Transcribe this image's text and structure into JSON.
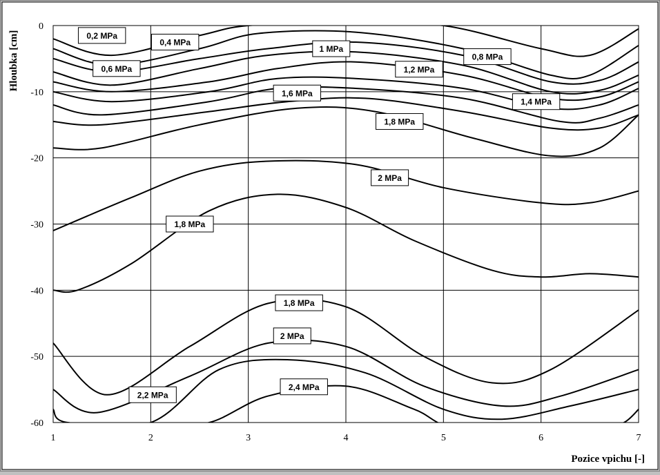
{
  "chart_data": {
    "type": "line",
    "title": "",
    "xlabel": "Pozice vpichu  [-]",
    "ylabel": "Hloubka  [cm]",
    "xlim": [
      1,
      7
    ],
    "ylim": [
      -60,
      0
    ],
    "x_ticks": [
      "1",
      "2",
      "3",
      "4",
      "5",
      "6",
      "7"
    ],
    "y_ticks": [
      "0",
      "-10",
      "-20",
      "-30",
      "-40",
      "-50",
      "-60"
    ],
    "grid": true,
    "legend": "none",
    "series": [
      {
        "x": [
          1,
          1.6,
          2.5,
          3,
          4,
          5,
          6,
          6.5,
          7
        ],
        "y": [
          -2,
          -4.5,
          -1.5,
          0,
          0.5,
          0,
          -3.5,
          -4.5,
          -0.5
        ]
      },
      {
        "x": [
          1,
          1.6,
          2.5,
          3.1,
          4.1,
          5.2,
          6.1,
          6.5,
          7
        ],
        "y": [
          -3.5,
          -6,
          -3.5,
          -1.2,
          -1,
          -3.5,
          -7.5,
          -7.5,
          -3
        ]
      },
      {
        "x": [
          1,
          1.6,
          2.5,
          3.2,
          4.1,
          5.2,
          6.1,
          6.6,
          7
        ],
        "y": [
          -5,
          -7,
          -5,
          -3.5,
          -2.5,
          -4.5,
          -8.5,
          -8.3,
          -5.5
        ]
      },
      {
        "x": [
          1,
          1.6,
          2.5,
          3.2,
          4.1,
          5.2,
          6.1,
          6.6,
          7
        ],
        "y": [
          -7,
          -9,
          -6.5,
          -4.5,
          -4,
          -6,
          -10,
          -9.8,
          -7.5
        ]
      },
      {
        "x": [
          1,
          1.6,
          2.6,
          3.3,
          4.1,
          5.2,
          6.1,
          6.6,
          7
        ],
        "y": [
          -8.5,
          -10,
          -8.5,
          -6.5,
          -5.5,
          -7.5,
          -11,
          -10.8,
          -8.5
        ]
      },
      {
        "x": [
          1,
          1.6,
          2.6,
          3.3,
          4.1,
          5.2,
          6.1,
          6.6,
          7
        ],
        "y": [
          -10,
          -11.5,
          -10,
          -8,
          -8,
          -9.5,
          -12.5,
          -12,
          -9.5
        ]
      },
      {
        "x": [
          1,
          1.5,
          2.6,
          3.3,
          4.1,
          5.2,
          6.2,
          6.6,
          7
        ],
        "y": [
          -12,
          -13.5,
          -11.5,
          -9.5,
          -9.5,
          -11,
          -14.5,
          -14,
          -12
        ]
      },
      {
        "x": [
          1,
          1.5,
          2.6,
          3.4,
          4.2,
          5.2,
          6.1,
          6.6,
          7
        ],
        "y": [
          -14.5,
          -15,
          -13,
          -11.5,
          -11,
          -13,
          -15.5,
          -15.5,
          -13.5
        ]
      },
      {
        "x": [
          1,
          1.5,
          2.5,
          3.5,
          4.3,
          5.3,
          6.1,
          6.6,
          7
        ],
        "y": [
          -18.5,
          -18.5,
          -15,
          -12.5,
          -13,
          -17,
          -19.7,
          -18.5,
          -13.5
        ]
      },
      {
        "x": [
          1,
          1.8,
          2.5,
          3.2,
          4.1,
          5,
          6,
          6.5,
          7
        ],
        "y": [
          -31,
          -26,
          -22,
          -20.5,
          -21,
          -24.5,
          -26.8,
          -26.8,
          -25
        ]
      },
      {
        "x": [
          1,
          1.25,
          1.8,
          2.6,
          3.3,
          4,
          4.7,
          5.5,
          6,
          6.5,
          7
        ],
        "y": [
          -40,
          -40,
          -36,
          -28,
          -25.5,
          -27.5,
          -32.5,
          -37,
          -38,
          -37.5,
          -38
        ]
      },
      {
        "x": [
          1,
          1.55,
          2.4,
          3.2,
          4,
          4.8,
          5.5,
          6.1,
          7
        ],
        "y": [
          -48,
          -55.8,
          -48.5,
          -42,
          -42.5,
          -50,
          -54,
          -52,
          -43
        ]
      },
      {
        "x": [
          1,
          1.45,
          2.4,
          3.2,
          4,
          4.8,
          5.6,
          6.2,
          7
        ],
        "y": [
          -55,
          -58.5,
          -53,
          -48,
          -48.5,
          -54.5,
          -57.5,
          -56,
          -52
        ]
      },
      {
        "x": [
          1,
          1.15,
          2,
          2.7,
          3.4,
          4.2,
          5,
          5.6,
          6.3,
          7
        ],
        "y": [
          -58,
          -60,
          -60,
          -52,
          -50.5,
          -52.5,
          -58,
          -59.5,
          -57.5,
          -55
        ]
      },
      {
        "x": [
          1.05,
          1.1,
          2,
          2.6,
          3.2,
          4,
          4.7,
          5.2,
          6.6,
          6.85,
          7
        ],
        "y": [
          -60,
          -60.5,
          -60.5,
          -60,
          -56,
          -54.5,
          -58,
          -61,
          -61,
          -60,
          -58
        ]
      }
    ],
    "labels": [
      {
        "text": "0,2 MPa",
        "x": 1.5,
        "y": -1.5
      },
      {
        "text": "0,4 MPa",
        "x": 2.25,
        "y": -2.5
      },
      {
        "text": "0,6 MPa",
        "x": 1.65,
        "y": -6.5
      },
      {
        "text": "1 MPa",
        "x": 3.85,
        "y": -3.5
      },
      {
        "text": "0,8 MPa",
        "x": 5.45,
        "y": -4.7
      },
      {
        "text": "1,2 MPa",
        "x": 4.75,
        "y": -6.6
      },
      {
        "text": "1,6 MPa",
        "x": 3.5,
        "y": -10.2
      },
      {
        "text": "1,4 MPa",
        "x": 5.95,
        "y": -11.5
      },
      {
        "text": "1,8 MPa",
        "x": 4.55,
        "y": -14.5
      },
      {
        "text": "2 MPa",
        "x": 4.45,
        "y": -23
      },
      {
        "text": "1,8 MPa",
        "x": 2.4,
        "y": -30
      },
      {
        "text": "1,8 MPa",
        "x": 3.52,
        "y": -41.9
      },
      {
        "text": "2 MPa",
        "x": 3.45,
        "y": -46.9
      },
      {
        "text": "2,2 MPa",
        "x": 2.02,
        "y": -55.8
      },
      {
        "text": "2,4 MPa",
        "x": 3.57,
        "y": -54.6
      }
    ]
  }
}
